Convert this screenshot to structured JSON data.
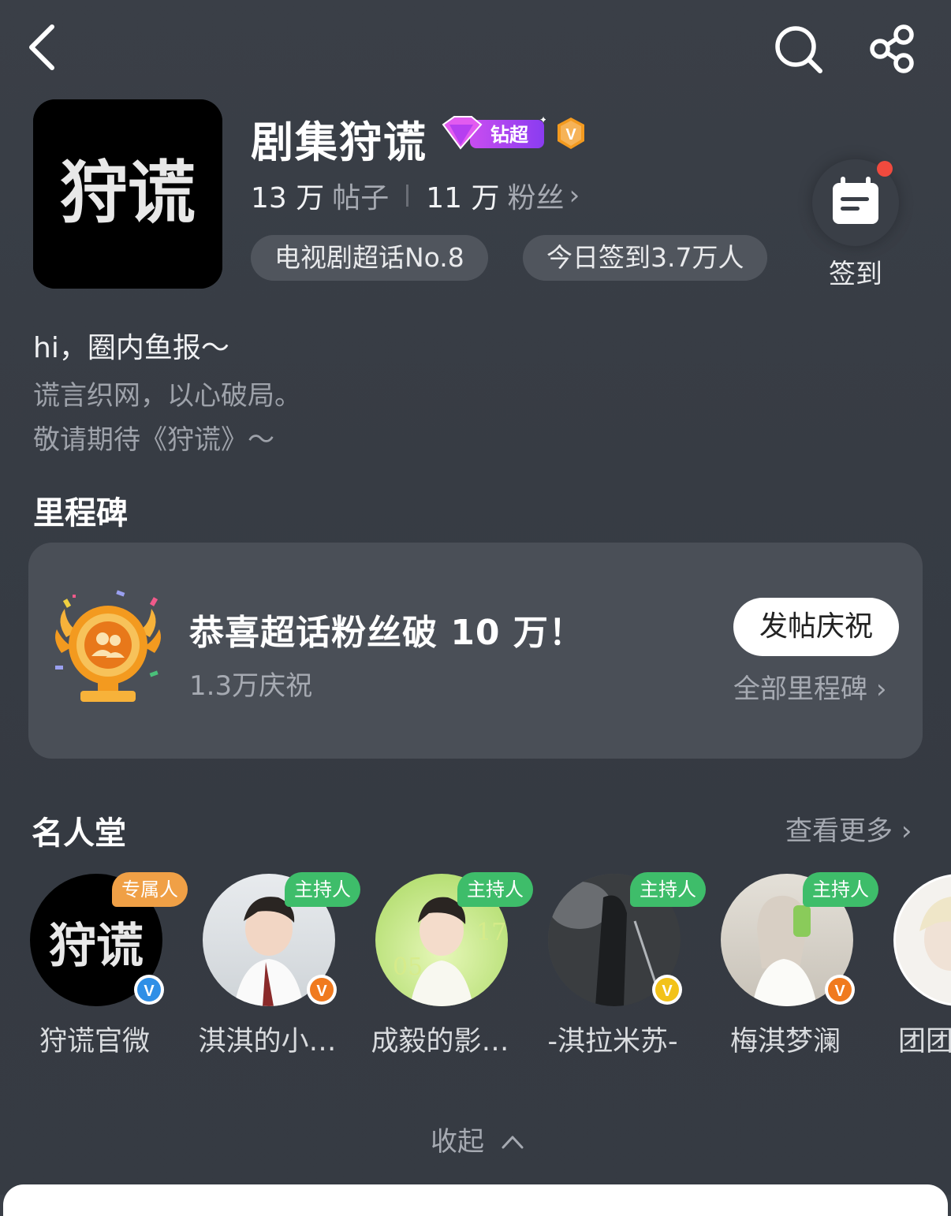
{
  "topbar": {
    "back_icon": "back-arrow-icon",
    "search_icon": "search-icon",
    "share_icon": "share-icon"
  },
  "header": {
    "cover_text": "狩谎",
    "title": "剧集狩谎",
    "diamond_badge": "钻超",
    "vip_badge": "V",
    "posts_count": "13 万",
    "posts_label": "帖子",
    "fans_count": "11 万",
    "fans_label": "粉丝",
    "rank_pill": "电视剧超话No.8",
    "checkin_pill": "今日签到3.7万人",
    "checkin_label": "签到"
  },
  "intro": {
    "line1": "hi，圈内鱼报～",
    "line2": "谎言织网，以心破局。",
    "line3": "敬请期待《狩谎》～"
  },
  "milestones": {
    "heading": "里程碑",
    "title": "恭喜超话粉丝破 10 万！",
    "subtitle": "1.3万庆祝",
    "celebrate_button": "发帖庆祝",
    "all_link": "全部里程碑"
  },
  "hall_of_fame": {
    "heading": "名人堂",
    "more_link": "查看更多",
    "members": [
      {
        "name": "狩谎官微",
        "role": "专属人",
        "role_type": "exclusive",
        "verify": "blue"
      },
      {
        "name": "淇淇的小…",
        "role": "主持人",
        "role_type": "host",
        "verify": "orange"
      },
      {
        "name": "成毅的影…",
        "role": "主持人",
        "role_type": "host",
        "verify": "orange"
      },
      {
        "name": "-淇拉米苏-",
        "role": "主持人",
        "role_type": "host",
        "verify": "gold"
      },
      {
        "name": "梅淇梦澜",
        "role": "主持人",
        "role_type": "host",
        "verify": "orange"
      },
      {
        "name": "团团",
        "role": "",
        "role_type": "none",
        "verify": "none"
      }
    ]
  },
  "collapse_label": "收起",
  "colors": {
    "background": "#383d45",
    "card": "#4a4f57",
    "host_green": "#3ebd6a",
    "exclusive_orange": "#f0a046",
    "accent_red": "#f04a3e"
  }
}
